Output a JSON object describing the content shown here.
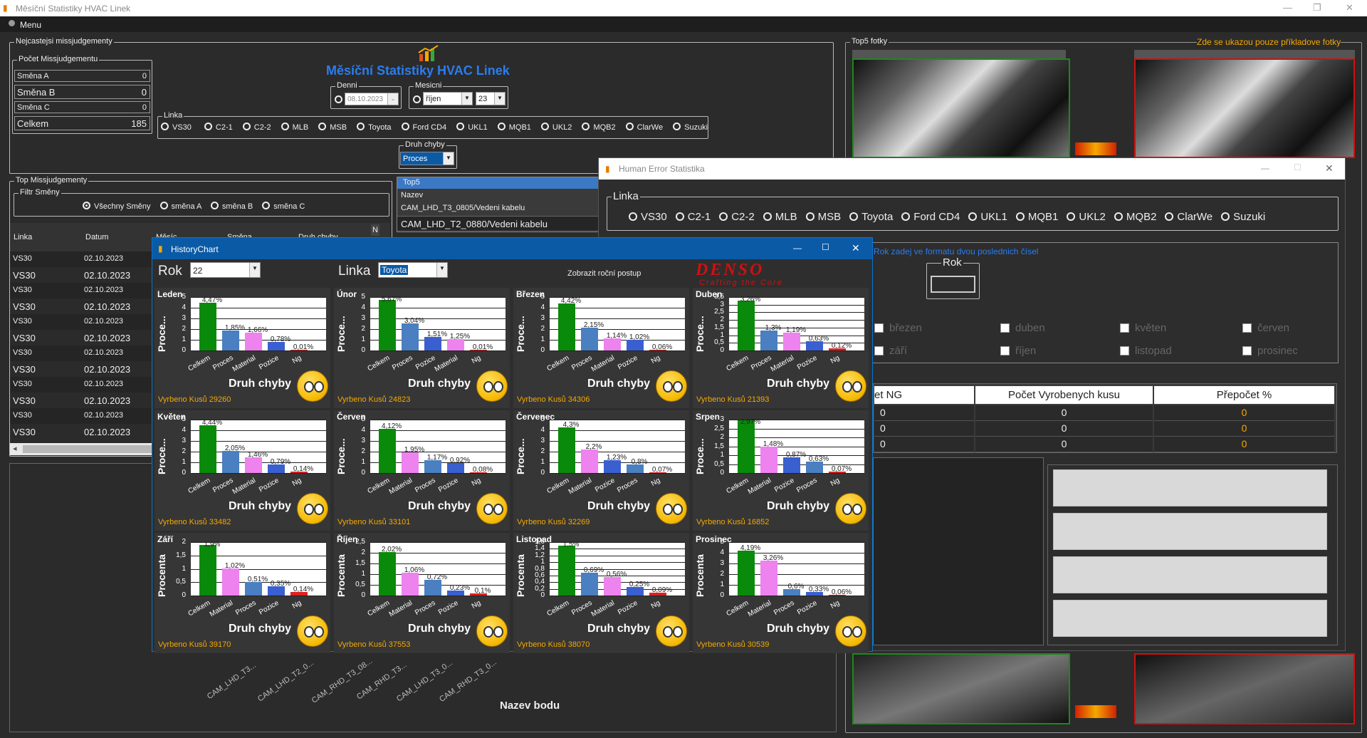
{
  "app": {
    "title": "Měsíční Statistiky HVAC Linek",
    "menu": "Menu",
    "heading": "Měsíční Statistiky HVAC Linek"
  },
  "nejcastejsi": {
    "legend": "Nejcastejsi missjudgementy",
    "pocet_legend": "Počet Missjudgementu",
    "rows": [
      {
        "label": "Směna A",
        "value": "0"
      },
      {
        "label": "Směna B",
        "value": "0"
      },
      {
        "label": "Směna C",
        "value": "0"
      },
      {
        "label": "Celkem",
        "value": "185"
      }
    ],
    "denni_legend": "Denni",
    "denni_value": "08.10.2023",
    "mesicni_legend": "Mesicni",
    "mesicni_month": "říjen",
    "mesicni_year": "23",
    "linka_legend": "Linka",
    "linky": [
      "VS30",
      "C2-1",
      "C2-2",
      "MLB",
      "MSB",
      "Toyota",
      "Ford CD4",
      "UKL1",
      "MQB1",
      "UKL2",
      "MQB2",
      "ClarWe",
      "Suzuki"
    ],
    "druh_legend": "Druh chyby",
    "druh_value": "Proces"
  },
  "top": {
    "legend": "Top Missjudgementy",
    "filtr_legend": "Filtr Směny",
    "filtr": [
      "Všechny Směny",
      "směna A",
      "směna B",
      "směna C"
    ],
    "columns": [
      "Linka",
      "Datum",
      "Měsíc",
      "Směna",
      "Druh chyby",
      "N"
    ],
    "rows": [
      {
        "linka": "VS30",
        "datum": "02.10.2023"
      },
      {
        "linka": "VS30",
        "datum": "02.10.2023"
      },
      {
        "linka": "VS30",
        "datum": "02.10.2023"
      },
      {
        "linka": "VS30",
        "datum": "02.10.2023"
      },
      {
        "linka": "VS30",
        "datum": "02.10.2023"
      },
      {
        "linka": "VS30",
        "datum": "02.10.2023"
      },
      {
        "linka": "VS30",
        "datum": "02.10.2023"
      },
      {
        "linka": "VS30",
        "datum": "02.10.2023"
      },
      {
        "linka": "VS30",
        "datum": "02.10.2023"
      },
      {
        "linka": "VS30",
        "datum": "02.10.2023"
      },
      {
        "linka": "VS30",
        "datum": "02.10.2023"
      },
      {
        "linka": "VS30",
        "datum": "02.10.2023"
      }
    ]
  },
  "top5": {
    "legend": "Top5",
    "header": "Nazev",
    "items": [
      "CAM_LHD_T3_0805/Vedeni kabelu",
      "CAM_LHD_T2_0880/Vedeni kabelu"
    ]
  },
  "top5fotky": {
    "legend": "Top5 fotky",
    "note": "Zde se ukazou pouze příkladove fotky"
  },
  "bottom": {
    "axis_title": "Nazev bodu",
    "labels": [
      "CAM_LHD_T3...",
      "CAM_LHD_T2_0...",
      "CAM_RHD_T3_08...",
      "CAM_RHD_T3...",
      "CAM_LHD_T3_0...",
      "CAM_RHD_T3_0..."
    ]
  },
  "history": {
    "title": "HistoryChart",
    "rok_label": "Rok",
    "rok_value": "22",
    "linka_label": "Linka",
    "linka_value": "Toyota",
    "zobrazit": "Zobrazit roční postup",
    "logo": "DENSO",
    "logo_sub": "Crafting the Core",
    "xtitle": "Druh chyby",
    "vyrobeno_prefix": "Vyrbeno Kusů"
  },
  "chart_data": [
    {
      "type": "bar",
      "title": "Leden",
      "ylabel": "Proce...",
      "ylim": [
        0,
        5
      ],
      "ticks": [
        "5",
        "4",
        "3",
        "2",
        "1",
        "0"
      ],
      "categories": [
        "Celkem",
        "Proces",
        "Material",
        "Pozice",
        "Ng"
      ],
      "values": [
        4.47,
        1.85,
        1.66,
        0.78,
        0.01
      ],
      "labels": [
        "4,47%",
        "1,85%",
        "1,66%",
        "0,78%",
        "0,01%"
      ],
      "colors": [
        "#0a8a0a",
        "#4a7fc1",
        "#ee82ee",
        "#3a5fd0",
        "#e02020"
      ],
      "vyrobeno": "29260"
    },
    {
      "type": "bar",
      "title": "Únor",
      "ylabel": "Proce...",
      "ylim": [
        0,
        6
      ],
      "ticks": [
        "5",
        "4",
        "3",
        "2",
        "1",
        "0"
      ],
      "categories": [
        "Celkem",
        "Proces",
        "Pozice",
        "Material",
        "Ng"
      ],
      "values": [
        5.67,
        3.04,
        1.51,
        1.25,
        0.01
      ],
      "labels": [
        "5,67%",
        "3,04%",
        "1,51%",
        "1,25%",
        "0,01%"
      ],
      "colors": [
        "#0a8a0a",
        "#4a7fc1",
        "#3a5fd0",
        "#ee82ee",
        "#e02020"
      ],
      "vyrobeno": "24823"
    },
    {
      "type": "bar",
      "title": "Březen",
      "ylabel": "Proce...",
      "ylim": [
        0,
        5
      ],
      "ticks": [
        "5",
        "4",
        "3",
        "2",
        "1",
        "0"
      ],
      "categories": [
        "Celkem",
        "Proces",
        "Material",
        "Pozice",
        "Ng"
      ],
      "values": [
        4.42,
        2.15,
        1.14,
        1.02,
        0.06
      ],
      "labels": [
        "4,42%",
        "2,15%",
        "1,14%",
        "1,02%",
        "0,06%"
      ],
      "colors": [
        "#0a8a0a",
        "#4a7fc1",
        "#ee82ee",
        "#3a5fd0",
        "#e02020"
      ],
      "vyrobeno": "34306"
    },
    {
      "type": "bar",
      "title": "Duben",
      "ylabel": "Proce...",
      "ylim": [
        0,
        3.5
      ],
      "ticks": [
        "3,5",
        "3",
        "2,5",
        "2",
        "1,5",
        "1",
        "0,5",
        "0"
      ],
      "categories": [
        "Celkem",
        "Proces",
        "Material",
        "Pozice",
        "Ng"
      ],
      "values": [
        3.26,
        1.3,
        1.19,
        0.63,
        0.12
      ],
      "labels": [
        "3,26%",
        "1,3%",
        "1,19%",
        "0,63%",
        "0,12%"
      ],
      "colors": [
        "#0a8a0a",
        "#4a7fc1",
        "#ee82ee",
        "#3a5fd0",
        "#e02020"
      ],
      "vyrobeno": "21393"
    },
    {
      "type": "bar",
      "title": "Květen",
      "ylabel": "Proce...",
      "ylim": [
        0,
        5
      ],
      "ticks": [
        "5",
        "4",
        "3",
        "2",
        "1",
        "0"
      ],
      "categories": [
        "Celkem",
        "Proces",
        "Material",
        "Pozice",
        "Ng"
      ],
      "values": [
        4.44,
        2.05,
        1.46,
        0.79,
        0.14
      ],
      "labels": [
        "4,44%",
        "2,05%",
        "1,46%",
        "0,79%",
        "0,14%"
      ],
      "colors": [
        "#0a8a0a",
        "#4a7fc1",
        "#ee82ee",
        "#3a5fd0",
        "#e02020"
      ],
      "vyrobeno": "33482"
    },
    {
      "type": "bar",
      "title": "Červen",
      "ylabel": "Proce...",
      "ylim": [
        0,
        5
      ],
      "ticks": [
        "5",
        "4",
        "3",
        "2",
        "1",
        "0"
      ],
      "categories": [
        "Celkem",
        "Material",
        "Proces",
        "Pozice",
        "Ng"
      ],
      "values": [
        4.12,
        1.95,
        1.17,
        0.92,
        0.08
      ],
      "labels": [
        "4,12%",
        "1,95%",
        "1,17%",
        "0,92%",
        "0,08%"
      ],
      "colors": [
        "#0a8a0a",
        "#ee82ee",
        "#4a7fc1",
        "#3a5fd0",
        "#e02020"
      ],
      "vyrobeno": "33101"
    },
    {
      "type": "bar",
      "title": "Červenec",
      "ylabel": "Proce...",
      "ylim": [
        0,
        5
      ],
      "ticks": [
        "5",
        "4",
        "3",
        "2",
        "1",
        "0"
      ],
      "categories": [
        "Celkem",
        "Material",
        "Pozice",
        "Proces",
        "Ng"
      ],
      "values": [
        4.3,
        2.2,
        1.23,
        0.8,
        0.07
      ],
      "labels": [
        "4,3%",
        "2,2%",
        "1,23%",
        "0,8%",
        "0,07%"
      ],
      "colors": [
        "#0a8a0a",
        "#ee82ee",
        "#3a5fd0",
        "#4a7fc1",
        "#e02020"
      ],
      "vyrobeno": "32269"
    },
    {
      "type": "bar",
      "title": "Srpen",
      "ylabel": "Proce...",
      "ylim": [
        0,
        3
      ],
      "ticks": [
        "3",
        "2,5",
        "2",
        "1,5",
        "1",
        "0,5",
        "0"
      ],
      "categories": [
        "Celkem",
        "Material",
        "Pozice",
        "Proces",
        "Ng"
      ],
      "values": [
        2.97,
        1.48,
        0.87,
        0.63,
        0.07
      ],
      "labels": [
        "2,97%",
        "1,48%",
        "0,87%",
        "0,63%",
        "0,07%"
      ],
      "colors": [
        "#0a8a0a",
        "#ee82ee",
        "#3a5fd0",
        "#4a7fc1",
        "#e02020"
      ],
      "vyrobeno": "16852"
    },
    {
      "type": "bar",
      "title": "Září",
      "ylabel": "Procenta",
      "ylim": [
        0,
        2
      ],
      "ticks": [
        "2",
        "1,5",
        "1",
        "0,5",
        "0"
      ],
      "categories": [
        "Celkem",
        "Material",
        "Proces",
        "Pozice",
        "Ng"
      ],
      "values": [
        1.9,
        1.02,
        0.51,
        0.35,
        0.14
      ],
      "labels": [
        "1,9%",
        "1,02%",
        "0,51%",
        "0,35%",
        "0,14%"
      ],
      "colors": [
        "#0a8a0a",
        "#ee82ee",
        "#4a7fc1",
        "#3a5fd0",
        "#e02020"
      ],
      "vyrobeno": "39170"
    },
    {
      "type": "bar",
      "title": "Říjen",
      "ylabel": "Procenta",
      "ylim": [
        0,
        2.5
      ],
      "ticks": [
        "2,5",
        "2",
        "1,5",
        "1",
        "0,5",
        "0"
      ],
      "categories": [
        "Celkem",
        "Material",
        "Proces",
        "Pozice",
        "Ng"
      ],
      "values": [
        2.02,
        1.06,
        0.72,
        0.23,
        0.1
      ],
      "labels": [
        "2,02%",
        "1,06%",
        "0,72%",
        "0,23%",
        "0,1%"
      ],
      "colors": [
        "#0a8a0a",
        "#ee82ee",
        "#4a7fc1",
        "#3a5fd0",
        "#e02020"
      ],
      "vyrobeno": "37553"
    },
    {
      "type": "bar",
      "title": "Listopad",
      "ylabel": "Procenta",
      "ylim": [
        0,
        1.6
      ],
      "ticks": [
        "1,6",
        "1,4",
        "1,2",
        "1",
        "0,8",
        "0,6",
        "0,4",
        "0,2",
        "0"
      ],
      "categories": [
        "Celkem",
        "Proces",
        "Material",
        "Pozice",
        "Ng"
      ],
      "values": [
        1.5,
        0.69,
        0.56,
        0.25,
        0.09
      ],
      "labels": [
        "1,5%",
        "0,69%",
        "0,56%",
        "0,25%",
        "0,09%"
      ],
      "colors": [
        "#0a8a0a",
        "#4a7fc1",
        "#ee82ee",
        "#3a5fd0",
        "#e02020"
      ],
      "vyrobeno": "38070"
    },
    {
      "type": "bar",
      "title": "Prosinec",
      "ylabel": "Procenta",
      "ylim": [
        0,
        5
      ],
      "ticks": [
        "5",
        "4",
        "3",
        "2",
        "1",
        "0"
      ],
      "categories": [
        "Celkem",
        "Material",
        "Proces",
        "Pozice",
        "Ng"
      ],
      "values": [
        4.19,
        3.26,
        0.6,
        0.33,
        0.06
      ],
      "labels": [
        "4,19%",
        "3,26%",
        "0,6%",
        "0,33%",
        "0,06%"
      ],
      "colors": [
        "#0a8a0a",
        "#ee82ee",
        "#4a7fc1",
        "#3a5fd0",
        "#e02020"
      ],
      "vyrobeno": "30539"
    }
  ],
  "human_error": {
    "title": "Human Error Statistika",
    "linka_legend": "Linka",
    "linky": [
      "VS30",
      "C2-1",
      "C2-2",
      "MLB",
      "MSB",
      "Toyota",
      "Ford CD4",
      "UKL1",
      "MQB1",
      "UKL2",
      "MQB2",
      "ClarWe",
      "Suzuki"
    ],
    "rok_hint": "Rok zadej ve formatu dvou poslednich čísel",
    "rok_legend": "Rok",
    "months_row1": [
      "březen",
      "duben",
      "květen",
      "červen"
    ],
    "months_row2": [
      "září",
      "říjen",
      "listopad",
      "prosinec"
    ],
    "table_headers": [
      "et NG",
      "Počet Vyrobenych kusu",
      "Přepočet %"
    ],
    "table_rows": [
      [
        "0",
        "0",
        "0"
      ],
      [
        "0",
        "0",
        "0"
      ],
      [
        "0",
        "0",
        "0"
      ]
    ]
  }
}
